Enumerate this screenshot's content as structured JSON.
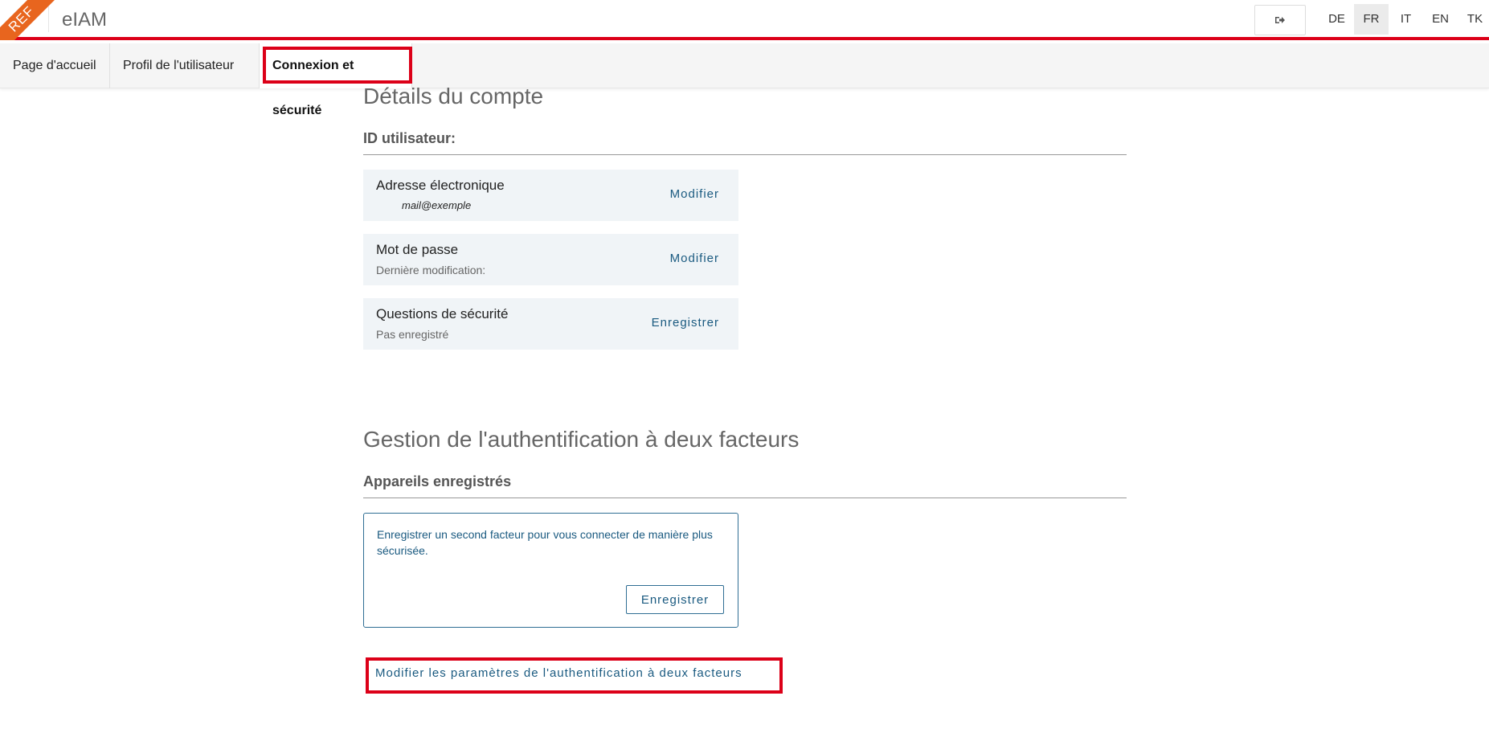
{
  "header": {
    "ref_badge": "REF",
    "app_title": "eIAM",
    "logout_icon": "logout-icon",
    "languages": [
      {
        "code": "DE",
        "active": false
      },
      {
        "code": "FR",
        "active": true
      },
      {
        "code": "IT",
        "active": false
      },
      {
        "code": "EN",
        "active": false
      },
      {
        "code": "TK",
        "active": false
      }
    ],
    "accent_color": "#dc0018",
    "ref_color": "#e8651e"
  },
  "nav": {
    "items": [
      {
        "label": "Page d'accueil",
        "active": false
      },
      {
        "label": "Profil de l'utilisateur",
        "active": false
      },
      {
        "label": "Connexion et sécurité",
        "active": true
      }
    ]
  },
  "account": {
    "title": "Détails du compte",
    "user_id_label": "ID utilisateur:",
    "cards": [
      {
        "label": "Adresse électronique",
        "sub": "mail@exemple",
        "action": "Modifier"
      },
      {
        "label": "Mot de passe",
        "sub": "Dernière modification:",
        "action": "Modifier"
      },
      {
        "label": "Questions de sécurité",
        "sub": "Pas enregistré",
        "action": "Enregistrer"
      }
    ]
  },
  "twofa": {
    "title": "Gestion de l'authentification à deux facteurs",
    "devices_label": "Appareils enregistrés",
    "box_text": "Enregistrer un second facteur pour vous connecter de manière plus sécurisée.",
    "box_button": "Enregistrer",
    "settings_link": "Modifier les paramètres de l'authentification à deux facteurs"
  }
}
